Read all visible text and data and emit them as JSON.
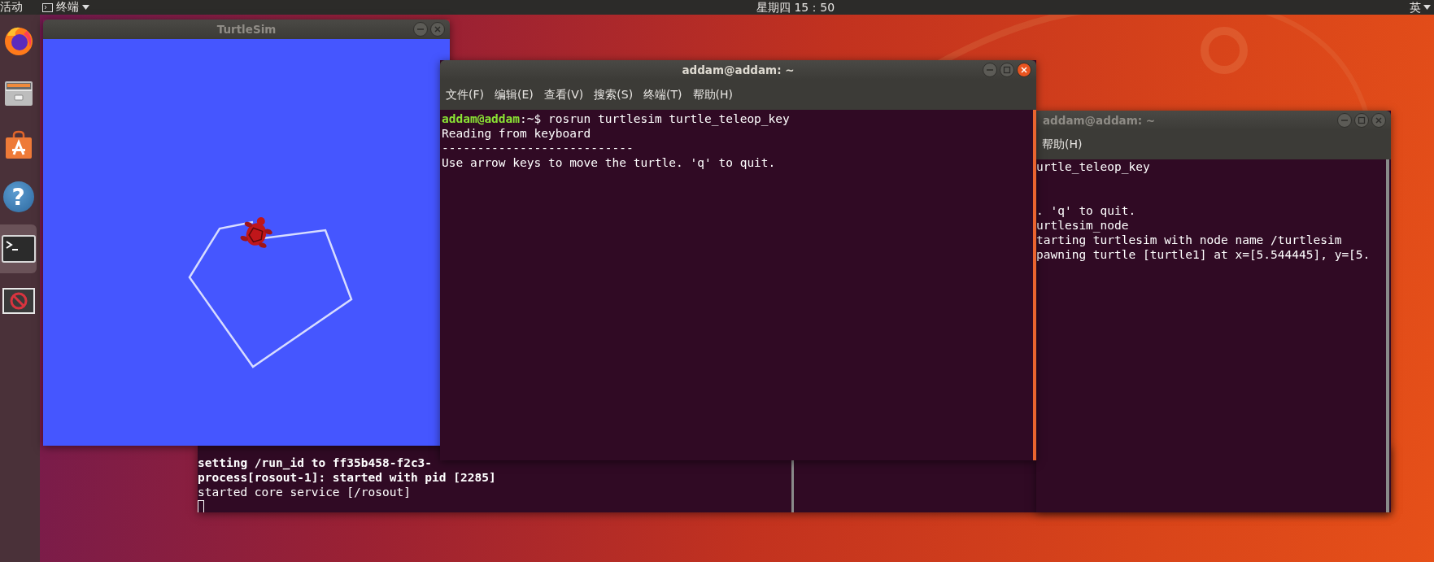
{
  "top_bar": {
    "activities": "活动",
    "app_menu": "终端",
    "clock": "星期四 15：50",
    "input_method": "英"
  },
  "dock": [
    {
      "kind": "browser",
      "selected": false
    },
    {
      "kind": "files",
      "selected": false
    },
    {
      "kind": "store",
      "selected": false
    },
    {
      "kind": "help",
      "glyph": "?",
      "selected": false
    },
    {
      "kind": "terminal",
      "selected": true
    },
    {
      "kind": "blocked",
      "selected": false
    }
  ],
  "background_terminal": {
    "lines": [
      {
        "kind": "bold",
        "text": "setting /run_id to ff35b458-f2c3-"
      },
      {
        "kind": "bold",
        "text": "process[rosout-1]: started with pid [2285]"
      },
      {
        "kind": "plain",
        "text": "started core service [/rosout]"
      },
      {
        "kind": "cursor"
      }
    ]
  },
  "right_terminal": {
    "title": "addam@addam: ~",
    "menu": [
      "帮助(H)"
    ],
    "lines": [
      {
        "kind": "plain",
        "text": "urtle_teleop_key"
      },
      {
        "kind": "blank"
      },
      {
        "kind": "blank"
      },
      {
        "kind": "plain",
        "text": ". 'q' to quit."
      },
      {
        "kind": "plain",
        "text": "urtlesim_node"
      },
      {
        "kind": "plain",
        "text": "tarting turtlesim with node name /turtlesim"
      },
      {
        "kind": "plain",
        "text": "pawning turtle [turtle1] at x=[5.544445], y=[5."
      }
    ]
  },
  "turtlesim": {
    "title": "TurtleSim"
  },
  "main_terminal": {
    "title": "addam@addam: ~",
    "menu": [
      "文件(F)",
      "编辑(E)",
      "查看(V)",
      "搜索(S)",
      "终端(T)",
      "帮助(H)"
    ],
    "lines": [
      {
        "kind": "prompt",
        "user": "addam@addam",
        "text": ":~$ rosrun turtlesim turtle_teleop_key"
      },
      {
        "kind": "plain",
        "text": "Reading from keyboard"
      },
      {
        "kind": "plain",
        "text": "---------------------------"
      },
      {
        "kind": "plain",
        "text": "Use arrow keys to move the turtle. 'q' to quit."
      }
    ]
  }
}
